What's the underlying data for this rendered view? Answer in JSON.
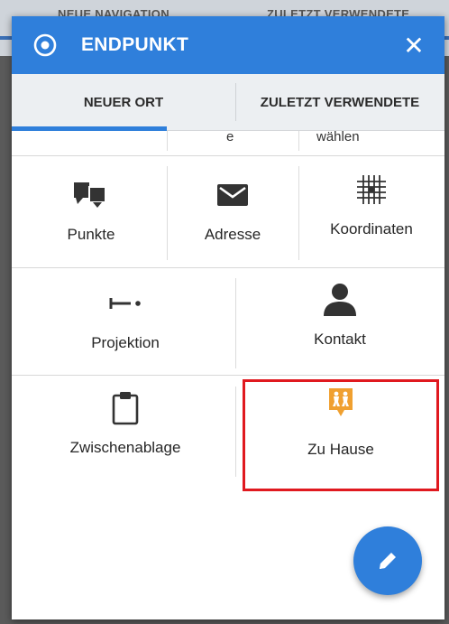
{
  "background": {
    "left_text": "NEUE NAVIGATION",
    "right_text": "ZULETZT VERWENDETE"
  },
  "header": {
    "title": "ENDPUNKT",
    "close_glyph": "✕"
  },
  "tabs": [
    {
      "label": "NEUER ORT",
      "active": true
    },
    {
      "label": "ZULETZT VERWENDETE",
      "active": false
    }
  ],
  "partial_row": {
    "middle_fragment": "e",
    "right_fragment": "wählen"
  },
  "grid": {
    "row1": [
      {
        "label": "Punkte",
        "icon": "points-icon"
      },
      {
        "label": "Adresse",
        "icon": "envelope-icon"
      },
      {
        "label": "Koordinaten",
        "icon": "grid-icon"
      }
    ],
    "row2": [
      {
        "label": "Projektion",
        "icon": "projection-icon"
      },
      {
        "label": "Kontakt",
        "icon": "contact-icon"
      }
    ],
    "row3": [
      {
        "label": "Zwischenablage",
        "icon": "clipboard-icon"
      },
      {
        "label": "Zu Hause",
        "icon": "home-family-icon"
      }
    ]
  },
  "colors": {
    "accent": "#2f7fdb",
    "highlight": "#e0191f",
    "home_icon": "#f0a030"
  },
  "fab": {
    "icon": "pencil-icon"
  }
}
